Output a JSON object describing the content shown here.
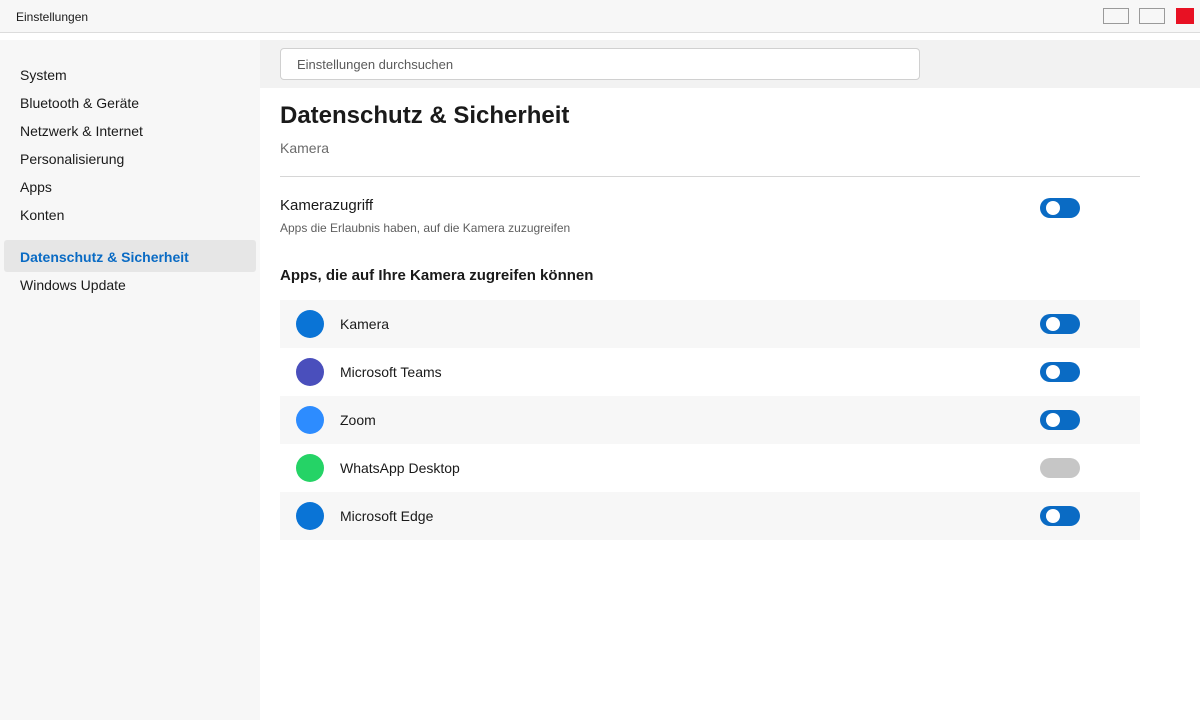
{
  "window": {
    "title": "Einstellungen"
  },
  "sidebar": {
    "items": [
      {
        "label": "System"
      },
      {
        "label": "Bluetooth & Geräte"
      },
      {
        "label": "Netzwerk & Internet"
      },
      {
        "label": "Personalisierung"
      },
      {
        "label": "Apps"
      },
      {
        "label": "Konten"
      },
      {
        "label": "Datenschutz & Sicherheit",
        "active": true
      },
      {
        "label": "Windows Update"
      }
    ]
  },
  "search": {
    "placeholder": "Einstellungen durchsuchen",
    "value": ""
  },
  "main": {
    "title": "Datenschutz & Sicherheit",
    "breadcrumb": "Kamera",
    "camera_access": {
      "title": "Kamerazugriff",
      "description": "Apps die Erlaubnis haben, auf die Kamera zuzugreifen",
      "enabled": true
    },
    "apps_section_title": "Apps, die auf Ihre Kamera zugreifen können",
    "apps": [
      {
        "name": "Kamera",
        "icon_color": "#0a74d6",
        "enabled": true
      },
      {
        "name": "Microsoft Teams",
        "icon_color": "#4a4fbc",
        "enabled": true
      },
      {
        "name": "Zoom",
        "icon_color": "#2d8cff",
        "enabled": true
      },
      {
        "name": "WhatsApp Desktop",
        "icon_color": "#25d366",
        "enabled": false
      },
      {
        "name": "Microsoft Edge",
        "icon_color": "#0a74d6",
        "enabled": true
      }
    ]
  },
  "colors": {
    "accent": "#0a6bc4",
    "close_button": "#e81123",
    "toggle_off": "#c6c6c6"
  }
}
